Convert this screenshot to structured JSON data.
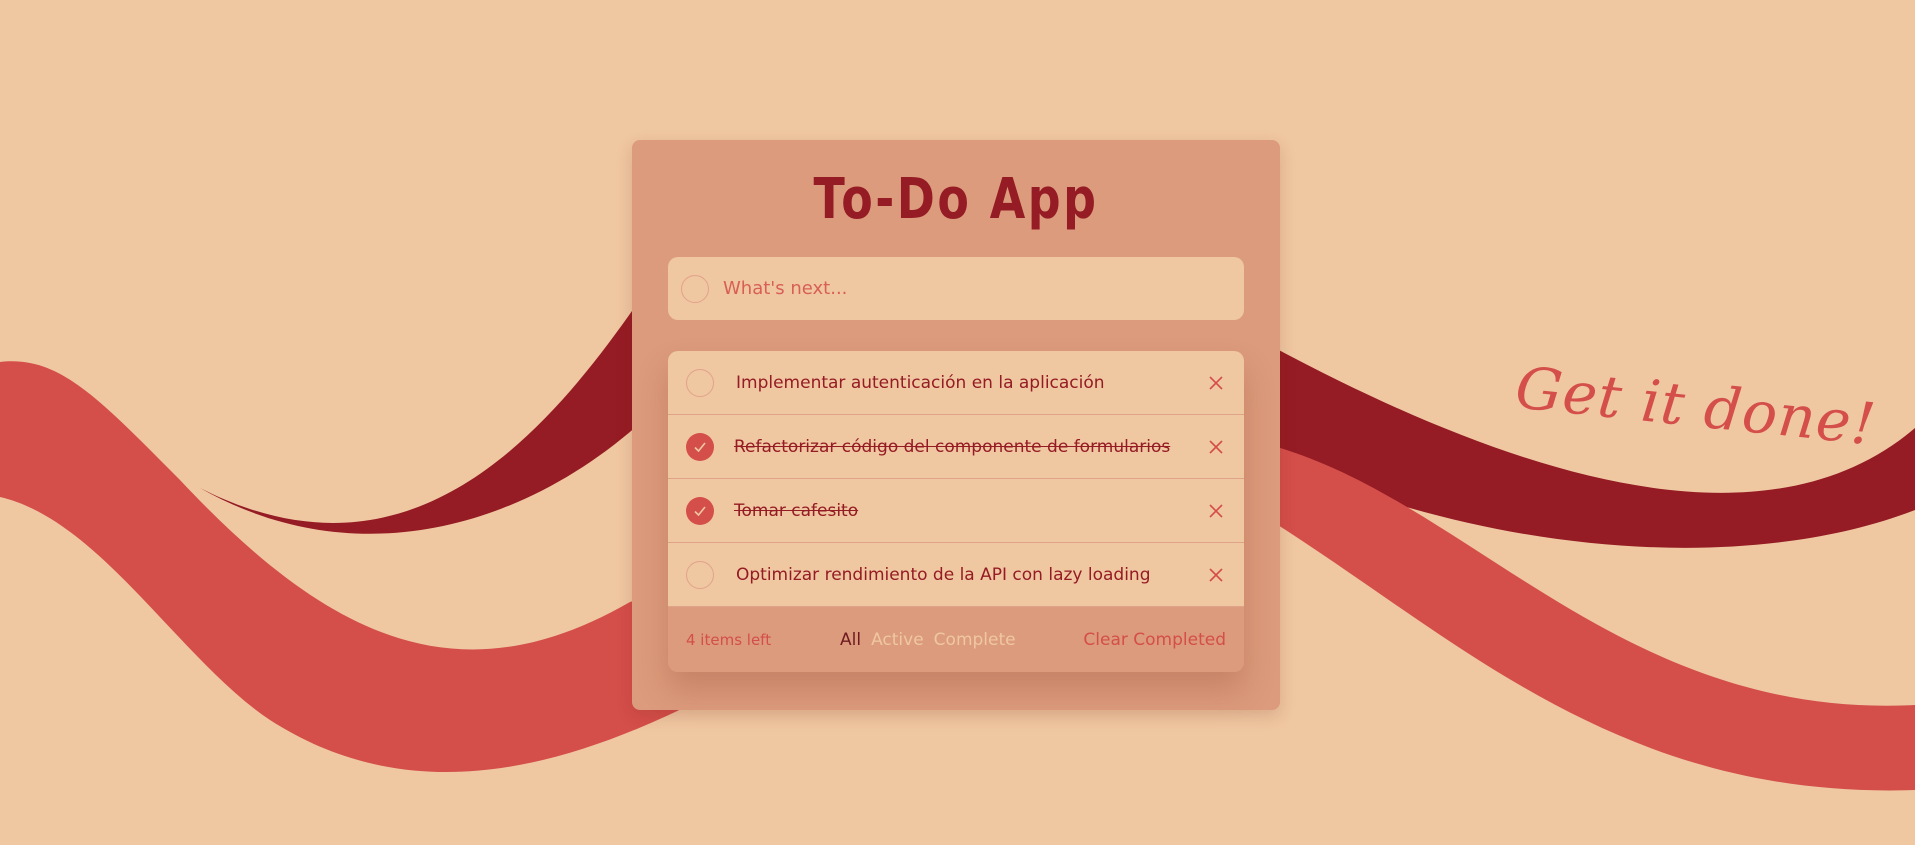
{
  "app": {
    "title": "To-Do App",
    "tagline": "Get it done!"
  },
  "new_todo": {
    "placeholder": "What's next...",
    "value": ""
  },
  "todos": [
    {
      "text": "Implementar autenticación en la aplicación",
      "completed": false
    },
    {
      "text": "Refactorizar código del componente de formularios",
      "completed": true
    },
    {
      "text": "Tomar cafesito",
      "completed": true
    },
    {
      "text": "Optimizar rendimiento de la API con lazy loading",
      "completed": false
    }
  ],
  "footer": {
    "items_left": "4 items left",
    "filters": [
      "All",
      "Active",
      "Complete"
    ],
    "active_filter": "All",
    "clear_label": "Clear Completed"
  },
  "icons": {
    "checkbox_empty": "circle-icon",
    "checkbox_checked": "check-icon",
    "delete": "close-icon"
  },
  "colors": {
    "background": "#efc7a1",
    "card": "#dc9b7c",
    "primary": "#951b24",
    "accent": "#d44e4a"
  }
}
